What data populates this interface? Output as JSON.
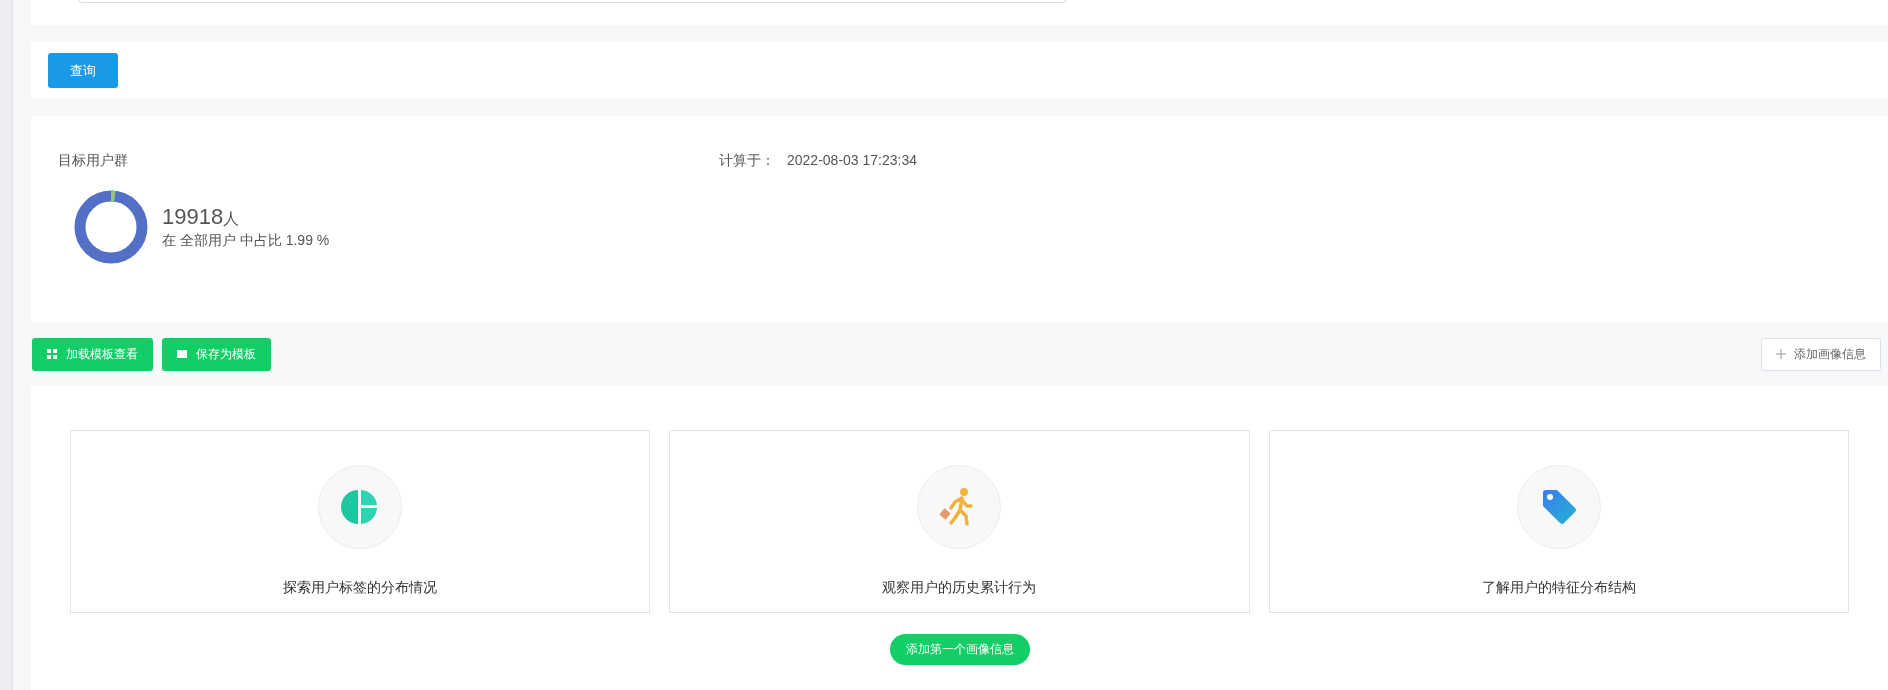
{
  "query_button": "查询",
  "summary": {
    "title": "目标用户群",
    "computed_label": "计算于：",
    "computed_time": "2022-08-03 17:23:34",
    "count": "19918",
    "count_unit": "人",
    "share_text": "在 全部用户 中占比 1.99 %",
    "level": 0.0199
  },
  "toolbar": {
    "buttons": [
      {
        "label": "加载模板查看",
        "kind": "grid"
      },
      {
        "label": "保存为模板",
        "kind": "book"
      }
    ],
    "add_button": "添加画像信息"
  },
  "cards": [
    {
      "label": "探索用户标签的分布情况",
      "kind": "pie"
    },
    {
      "label": "观察用户的历史累计行为",
      "kind": "walker"
    },
    {
      "label": "了解用户的特征分布结构",
      "kind": "tag"
    }
  ],
  "add_first_button": "添加第一个画像信息"
}
